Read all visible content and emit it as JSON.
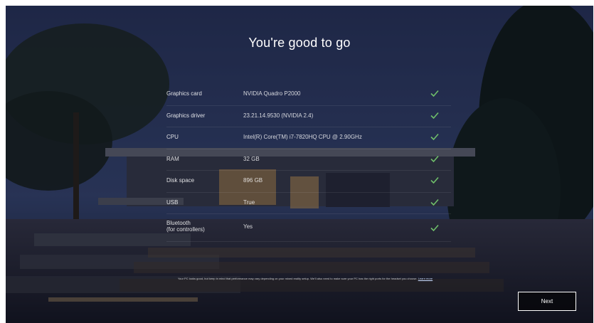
{
  "heading": "You're good to go",
  "specs": [
    {
      "label": "Graphics card",
      "value": "NVIDIA Quadro P2000"
    },
    {
      "label": "Graphics driver",
      "value": "23.21.14.9530 (NVIDIA 2.4)"
    },
    {
      "label": "CPU",
      "value": "Intel(R) Core(TM) i7-7820HQ CPU @ 2.90GHz"
    },
    {
      "label": "RAM",
      "value": "32 GB"
    },
    {
      "label": "Disk space",
      "value": "896 GB"
    },
    {
      "label": "USB",
      "value": "True"
    },
    {
      "label": "Bluetooth",
      "label_line2": "(for controllers)",
      "value": "Yes"
    }
  ],
  "footnote": {
    "text": "Your PC looks good, but keep in mind that performance may vary depending on your mixed reality setup. We'll also need to make sure your PC has the right ports for the headset you choose.",
    "link": "Learn more"
  },
  "next_button": "Next",
  "icons": {
    "check": "check-icon"
  },
  "colors": {
    "check": "#6fbf6a",
    "background": "#24304f"
  }
}
